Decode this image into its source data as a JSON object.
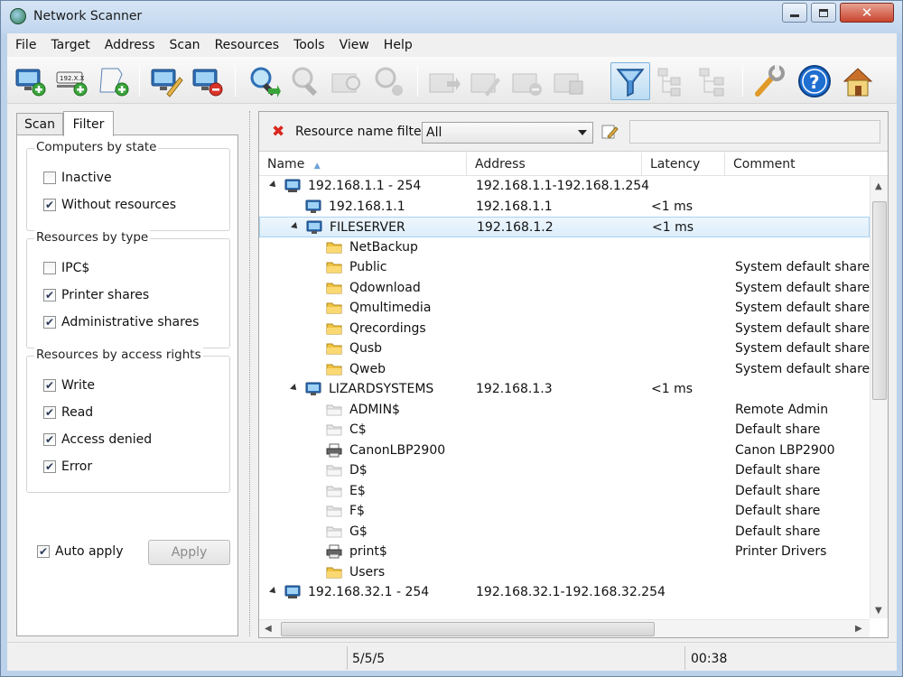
{
  "window": {
    "title": "Network Scanner"
  },
  "menu": [
    "File",
    "Target",
    "Address",
    "Scan",
    "Resources",
    "Tools",
    "View",
    "Help"
  ],
  "left": {
    "tabs": {
      "scan": "Scan",
      "filter": "Filter"
    },
    "groups": [
      {
        "title": "Computers by state",
        "items": [
          {
            "label": "Inactive",
            "checked": false
          },
          {
            "label": "Without resources",
            "checked": true
          }
        ]
      },
      {
        "title": "Resources by type",
        "items": [
          {
            "label": "IPC$",
            "checked": false
          },
          {
            "label": "Printer shares",
            "checked": true
          },
          {
            "label": "Administrative shares",
            "checked": true
          }
        ]
      },
      {
        "title": "Resources by access rights",
        "items": [
          {
            "label": "Write",
            "checked": true
          },
          {
            "label": "Read",
            "checked": true
          },
          {
            "label": "Access denied",
            "checked": true
          },
          {
            "label": "Error",
            "checked": true
          }
        ]
      }
    ],
    "auto_apply": {
      "label": "Auto apply",
      "checked": true
    },
    "apply_label": "Apply"
  },
  "filter": {
    "label": "Resource name filter",
    "value": "All"
  },
  "columns": {
    "name": "Name",
    "address": "Address",
    "latency": "Latency",
    "comment": "Comment"
  },
  "rows": [
    {
      "level": 0,
      "expander": true,
      "icon": "network",
      "name": "192.168.1.1 - 254",
      "address": "192.168.1.1-192.168.1.254",
      "latency": "",
      "comment": ""
    },
    {
      "level": 1,
      "expander": false,
      "icon": "computer",
      "name": "192.168.1.1",
      "address": "192.168.1.1",
      "latency": "<1 ms",
      "comment": ""
    },
    {
      "level": 1,
      "expander": true,
      "icon": "computer",
      "name": "FILESERVER",
      "address": "192.168.1.2",
      "latency": "<1 ms",
      "comment": "",
      "selected": true
    },
    {
      "level": 2,
      "expander": false,
      "icon": "folder",
      "name": "NetBackup",
      "address": "",
      "latency": "",
      "comment": ""
    },
    {
      "level": 2,
      "expander": false,
      "icon": "folder",
      "name": "Public",
      "address": "",
      "latency": "",
      "comment": "System default share"
    },
    {
      "level": 2,
      "expander": false,
      "icon": "folder",
      "name": "Qdownload",
      "address": "",
      "latency": "",
      "comment": "System default share"
    },
    {
      "level": 2,
      "expander": false,
      "icon": "folder",
      "name": "Qmultimedia",
      "address": "",
      "latency": "",
      "comment": "System default share"
    },
    {
      "level": 2,
      "expander": false,
      "icon": "folder",
      "name": "Qrecordings",
      "address": "",
      "latency": "",
      "comment": "System default share"
    },
    {
      "level": 2,
      "expander": false,
      "icon": "folder",
      "name": "Qusb",
      "address": "",
      "latency": "",
      "comment": "System default share"
    },
    {
      "level": 2,
      "expander": false,
      "icon": "folder",
      "name": "Qweb",
      "address": "",
      "latency": "",
      "comment": "System default share"
    },
    {
      "level": 1,
      "expander": true,
      "icon": "computer",
      "name": "LIZARDSYSTEMS",
      "address": "192.168.1.3",
      "latency": "<1 ms",
      "comment": ""
    },
    {
      "level": 2,
      "expander": false,
      "icon": "folder-gray",
      "name": "ADMIN$",
      "address": "",
      "latency": "",
      "comment": "Remote Admin"
    },
    {
      "level": 2,
      "expander": false,
      "icon": "folder-gray",
      "name": "C$",
      "address": "",
      "latency": "",
      "comment": "Default share"
    },
    {
      "level": 2,
      "expander": false,
      "icon": "printer",
      "name": "CanonLBP2900",
      "address": "",
      "latency": "",
      "comment": "Canon LBP2900"
    },
    {
      "level": 2,
      "expander": false,
      "icon": "folder-gray",
      "name": "D$",
      "address": "",
      "latency": "",
      "comment": "Default share"
    },
    {
      "level": 2,
      "expander": false,
      "icon": "folder-gray",
      "name": "E$",
      "address": "",
      "latency": "",
      "comment": "Default share"
    },
    {
      "level": 2,
      "expander": false,
      "icon": "folder-gray",
      "name": "F$",
      "address": "",
      "latency": "",
      "comment": "Default share"
    },
    {
      "level": 2,
      "expander": false,
      "icon": "folder-gray",
      "name": "G$",
      "address": "",
      "latency": "",
      "comment": "Default share"
    },
    {
      "level": 2,
      "expander": false,
      "icon": "printer",
      "name": "print$",
      "address": "",
      "latency": "",
      "comment": "Printer Drivers"
    },
    {
      "level": 2,
      "expander": false,
      "icon": "folder",
      "name": "Users",
      "address": "",
      "latency": "",
      "comment": ""
    },
    {
      "level": 0,
      "expander": true,
      "icon": "network",
      "name": "192.168.32.1 - 254",
      "address": "192.168.32.1-192.168.32.254",
      "latency": "",
      "comment": ""
    }
  ],
  "status": {
    "count": "5/5/5",
    "time": "00:38"
  },
  "toolbar_icons": [
    "add-computer-icon",
    "add-ip-range-icon",
    "add-from-file-icon",
    "edit-computer-icon",
    "remove-computer-icon",
    "scan-icon",
    "scan-selected-icon",
    "scan-folder-icon",
    "stop-scan-icon",
    "export-icon",
    "edit-resource-icon",
    "remove-resource-icon",
    "resource-properties-icon",
    "filter-icon",
    "tree-expand-icon",
    "tree-collapse-icon",
    "options-icon",
    "help-icon",
    "home-icon"
  ]
}
